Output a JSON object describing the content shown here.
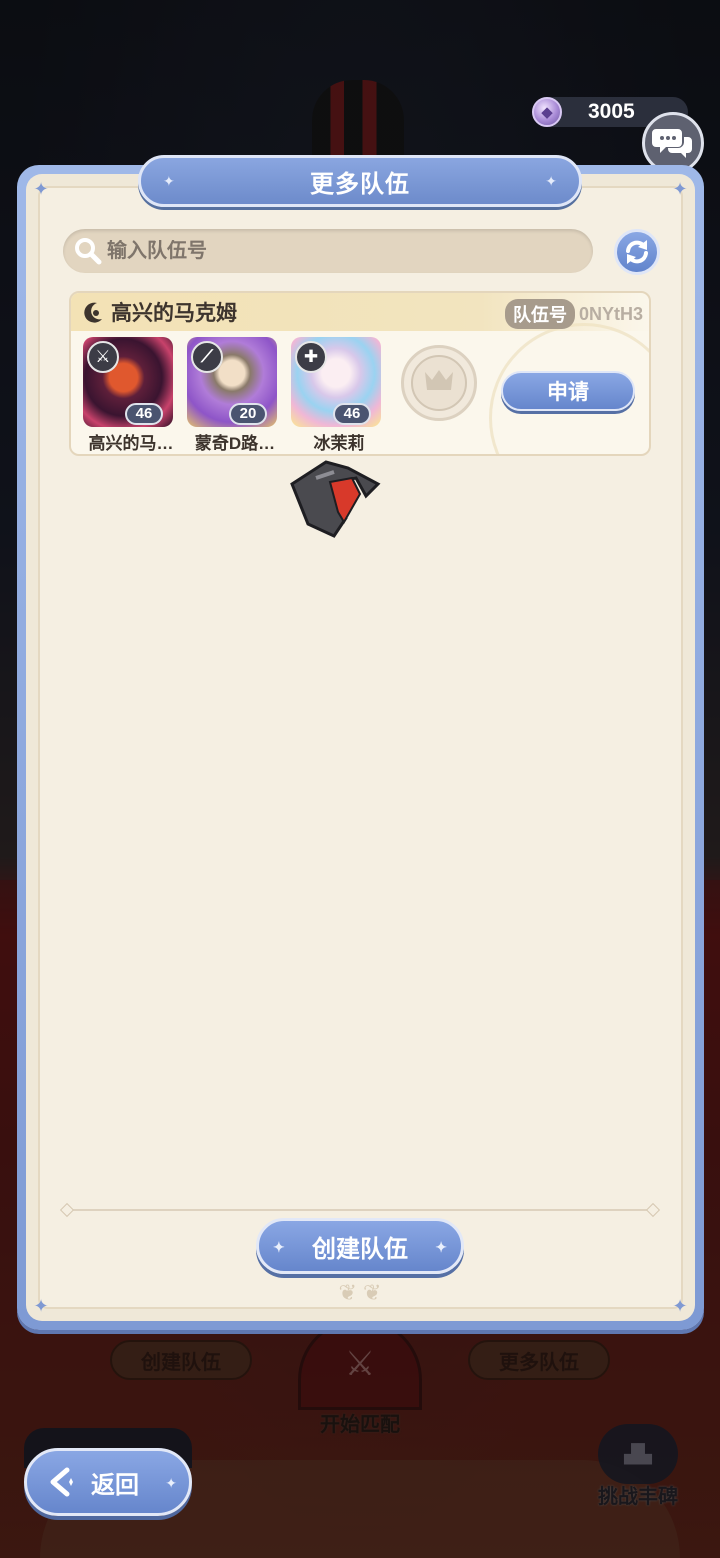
{
  "currency": {
    "value": "3005",
    "icon": "gem-icon"
  },
  "panel": {
    "title": "更多队伍",
    "search_placeholder": "输入队伍号",
    "teams": [
      {
        "leader": "高兴的马克姆",
        "team_no_label": "队伍号",
        "team_no": "0NYtH3",
        "members": [
          {
            "name": "高兴的马…",
            "level": "46",
            "class_icon": "sword-icon"
          },
          {
            "name": "蒙奇D路…",
            "level": "20",
            "class_icon": "wand-icon"
          },
          {
            "name": "冰茉莉",
            "level": "46",
            "class_icon": "cross-icon"
          }
        ],
        "apply_label": "申请"
      }
    ],
    "create_label": "创建队伍"
  },
  "background": {
    "create_team": "创建队伍",
    "more_teams": "更多队伍",
    "start_match": "开始匹配",
    "challenge_monument": "挑战丰碑"
  },
  "back_label": "返回",
  "colors": {
    "accent": "#7190d4",
    "paper": "#f5efe2",
    "card_header": "#f3e2b5"
  }
}
